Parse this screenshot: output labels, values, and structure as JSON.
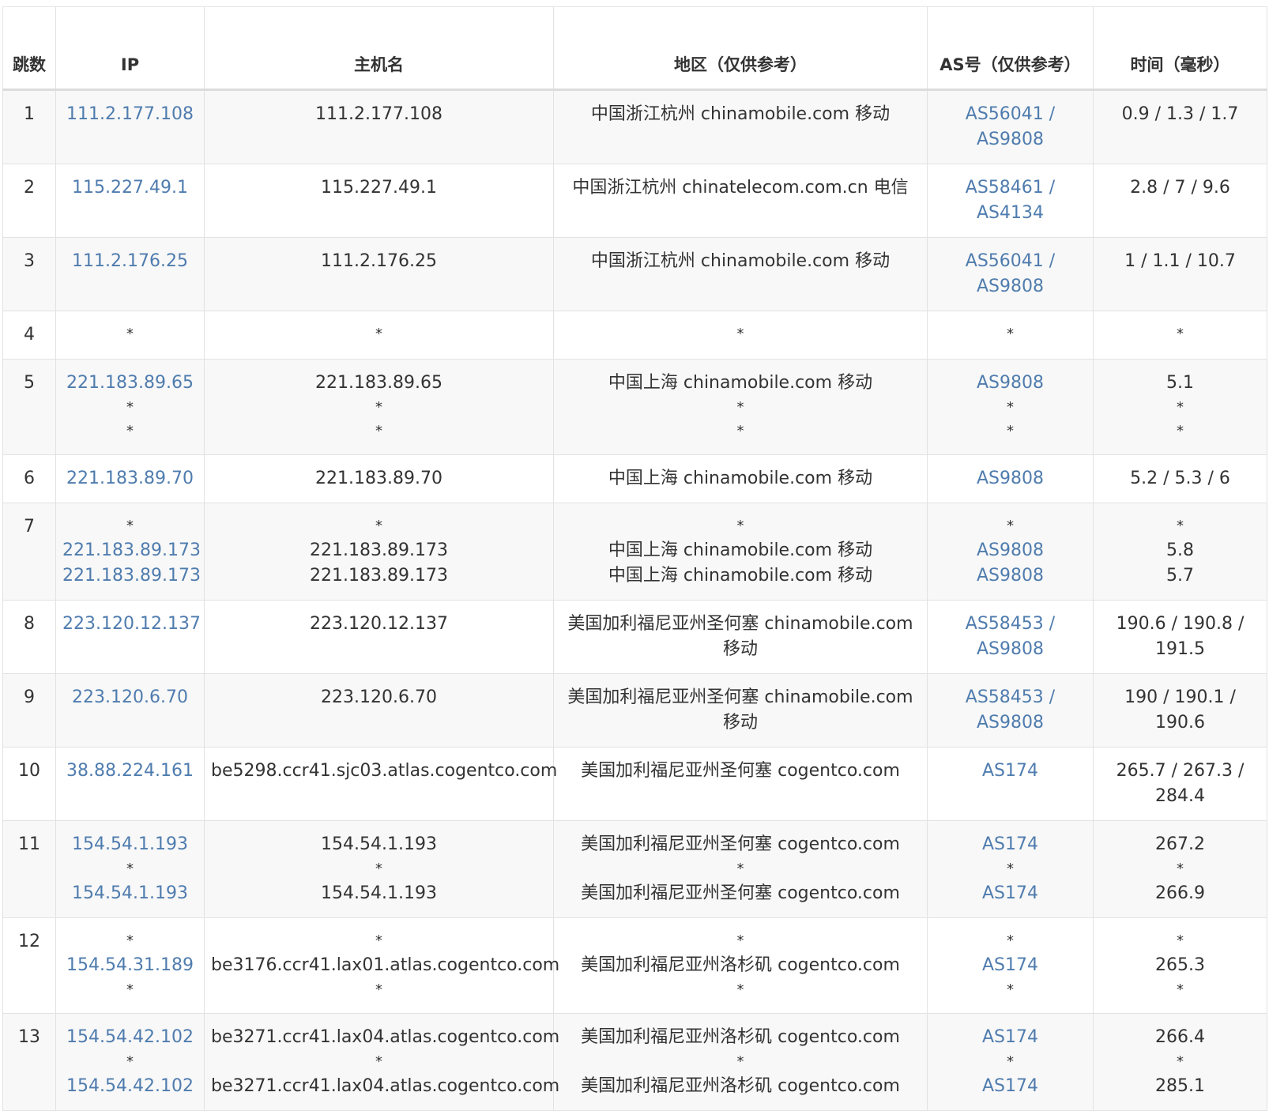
{
  "headers": {
    "hop": "跳数",
    "ip": "IP",
    "host": "主机名",
    "region": "地区（仅供参考）",
    "as": "AS号（仅供参考）",
    "time": "时间（毫秒）"
  },
  "rows": [
    {
      "hop": "1",
      "ip": [
        "111.2.177.108"
      ],
      "host": [
        "111.2.177.108"
      ],
      "region": [
        "中国浙江杭州 chinamobile.com 移动"
      ],
      "as": [
        "AS56041 / AS9808"
      ],
      "time": [
        "0.9 / 1.3 / 1.7"
      ]
    },
    {
      "hop": "2",
      "ip": [
        "115.227.49.1"
      ],
      "host": [
        "115.227.49.1"
      ],
      "region": [
        "中国浙江杭州 chinatelecom.com.cn 电信"
      ],
      "as": [
        "AS58461 / AS4134"
      ],
      "time": [
        "2.8 / 7 / 9.6"
      ]
    },
    {
      "hop": "3",
      "ip": [
        "111.2.176.25"
      ],
      "host": [
        "111.2.176.25"
      ],
      "region": [
        "中国浙江杭州 chinamobile.com 移动"
      ],
      "as": [
        "AS56041 / AS9808"
      ],
      "time": [
        "1 / 1.1 / 10.7"
      ]
    },
    {
      "hop": "4",
      "ip": [
        "*"
      ],
      "host": [
        "*"
      ],
      "region": [
        "*"
      ],
      "as": [
        "*"
      ],
      "time": [
        "*"
      ]
    },
    {
      "hop": "5",
      "ip": [
        "221.183.89.65",
        "*",
        "*"
      ],
      "host": [
        "221.183.89.65",
        "*",
        "*"
      ],
      "region": [
        "中国上海 chinamobile.com 移动",
        "*",
        "*"
      ],
      "as": [
        "AS9808",
        "*",
        "*"
      ],
      "time": [
        "5.1",
        "*",
        "*"
      ]
    },
    {
      "hop": "6",
      "ip": [
        "221.183.89.70"
      ],
      "host": [
        "221.183.89.70"
      ],
      "region": [
        "中国上海 chinamobile.com 移动"
      ],
      "as": [
        "AS9808"
      ],
      "time": [
        "5.2 / 5.3 / 6"
      ]
    },
    {
      "hop": "7",
      "ip": [
        "*",
        "221.183.89.173",
        "221.183.89.173"
      ],
      "host": [
        "*",
        "221.183.89.173",
        "221.183.89.173"
      ],
      "region": [
        "*",
        "中国上海 chinamobile.com 移动",
        "中国上海 chinamobile.com 移动"
      ],
      "as": [
        "*",
        "AS9808",
        "AS9808"
      ],
      "time": [
        "*",
        "5.8",
        "5.7"
      ]
    },
    {
      "hop": "8",
      "ip": [
        "223.120.12.137"
      ],
      "host": [
        "223.120.12.137"
      ],
      "region": [
        "美国加利福尼亚州圣何塞 chinamobile.com 移动"
      ],
      "as": [
        "AS58453 / AS9808"
      ],
      "time": [
        "190.6 / 190.8 / 191.5"
      ]
    },
    {
      "hop": "9",
      "ip": [
        "223.120.6.70"
      ],
      "host": [
        "223.120.6.70"
      ],
      "region": [
        "美国加利福尼亚州圣何塞 chinamobile.com 移动"
      ],
      "as": [
        "AS58453 / AS9808"
      ],
      "time": [
        "190 / 190.1 / 190.6"
      ]
    },
    {
      "hop": "10",
      "ip": [
        "38.88.224.161"
      ],
      "host": [
        "be5298.ccr41.sjc03.atlas.cogentco.com"
      ],
      "region": [
        "美国加利福尼亚州圣何塞 cogentco.com"
      ],
      "as": [
        "AS174"
      ],
      "time": [
        "265.7 / 267.3 / 284.4"
      ]
    },
    {
      "hop": "11",
      "ip": [
        "154.54.1.193",
        "*",
        "154.54.1.193"
      ],
      "host": [
        "154.54.1.193",
        "*",
        "154.54.1.193"
      ],
      "region": [
        "美国加利福尼亚州圣何塞 cogentco.com",
        "*",
        "美国加利福尼亚州圣何塞 cogentco.com"
      ],
      "as": [
        "AS174",
        "*",
        "AS174"
      ],
      "time": [
        "267.2",
        "*",
        "266.9"
      ]
    },
    {
      "hop": "12",
      "ip": [
        "*",
        "154.54.31.189",
        "*"
      ],
      "host": [
        "*",
        "be3176.ccr41.lax01.atlas.cogentco.com",
        "*"
      ],
      "region": [
        "*",
        "美国加利福尼亚州洛杉矶 cogentco.com",
        "*"
      ],
      "as": [
        "*",
        "AS174",
        "*"
      ],
      "time": [
        "*",
        "265.3",
        "*"
      ]
    },
    {
      "hop": "13",
      "ip": [
        "154.54.42.102",
        "*",
        "154.54.42.102"
      ],
      "host": [
        "be3271.ccr41.lax04.atlas.cogentco.com",
        "*",
        "be3271.ccr41.lax04.atlas.cogentco.com"
      ],
      "region": [
        "美国加利福尼亚州洛杉矶 cogentco.com",
        "*",
        "美国加利福尼亚州洛杉矶 cogentco.com"
      ],
      "as": [
        "AS174",
        "*",
        "AS174"
      ],
      "time": [
        "266.4",
        "*",
        "285.1"
      ]
    }
  ]
}
